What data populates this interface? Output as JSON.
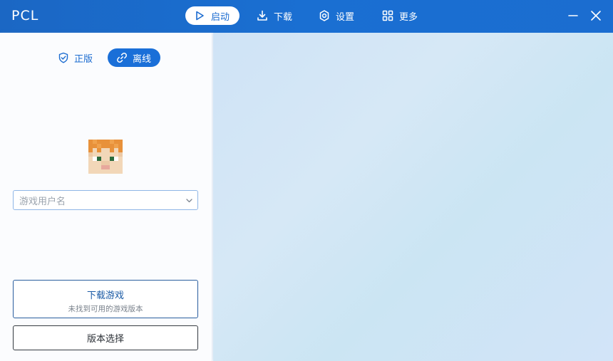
{
  "app": {
    "title": "PCL"
  },
  "nav": {
    "launch": {
      "label": "启动",
      "icon": "play-icon"
    },
    "download": {
      "label": "下载",
      "icon": "download-icon"
    },
    "settings": {
      "label": "设置",
      "icon": "gear-icon"
    },
    "more": {
      "label": "更多",
      "icon": "grid-icon"
    }
  },
  "window": {
    "minimize_icon": "minimize-icon",
    "close_icon": "close-icon"
  },
  "login_mode": {
    "genuine": {
      "label": "正版",
      "icon": "shield-check-icon"
    },
    "offline": {
      "label": "离线",
      "icon": "link-icon",
      "selected": true
    }
  },
  "profile": {
    "avatar": "player-skin-head",
    "username_placeholder": "游戏用户名"
  },
  "actions": {
    "download_game": {
      "label": "下载游戏",
      "sub": "未找到可用的游戏版本"
    },
    "version_select": {
      "label": "版本选择"
    }
  },
  "colors": {
    "titlebar": "#1a6bd0",
    "accent": "#1a6fd8",
    "background_main": "#d2e6f6"
  }
}
